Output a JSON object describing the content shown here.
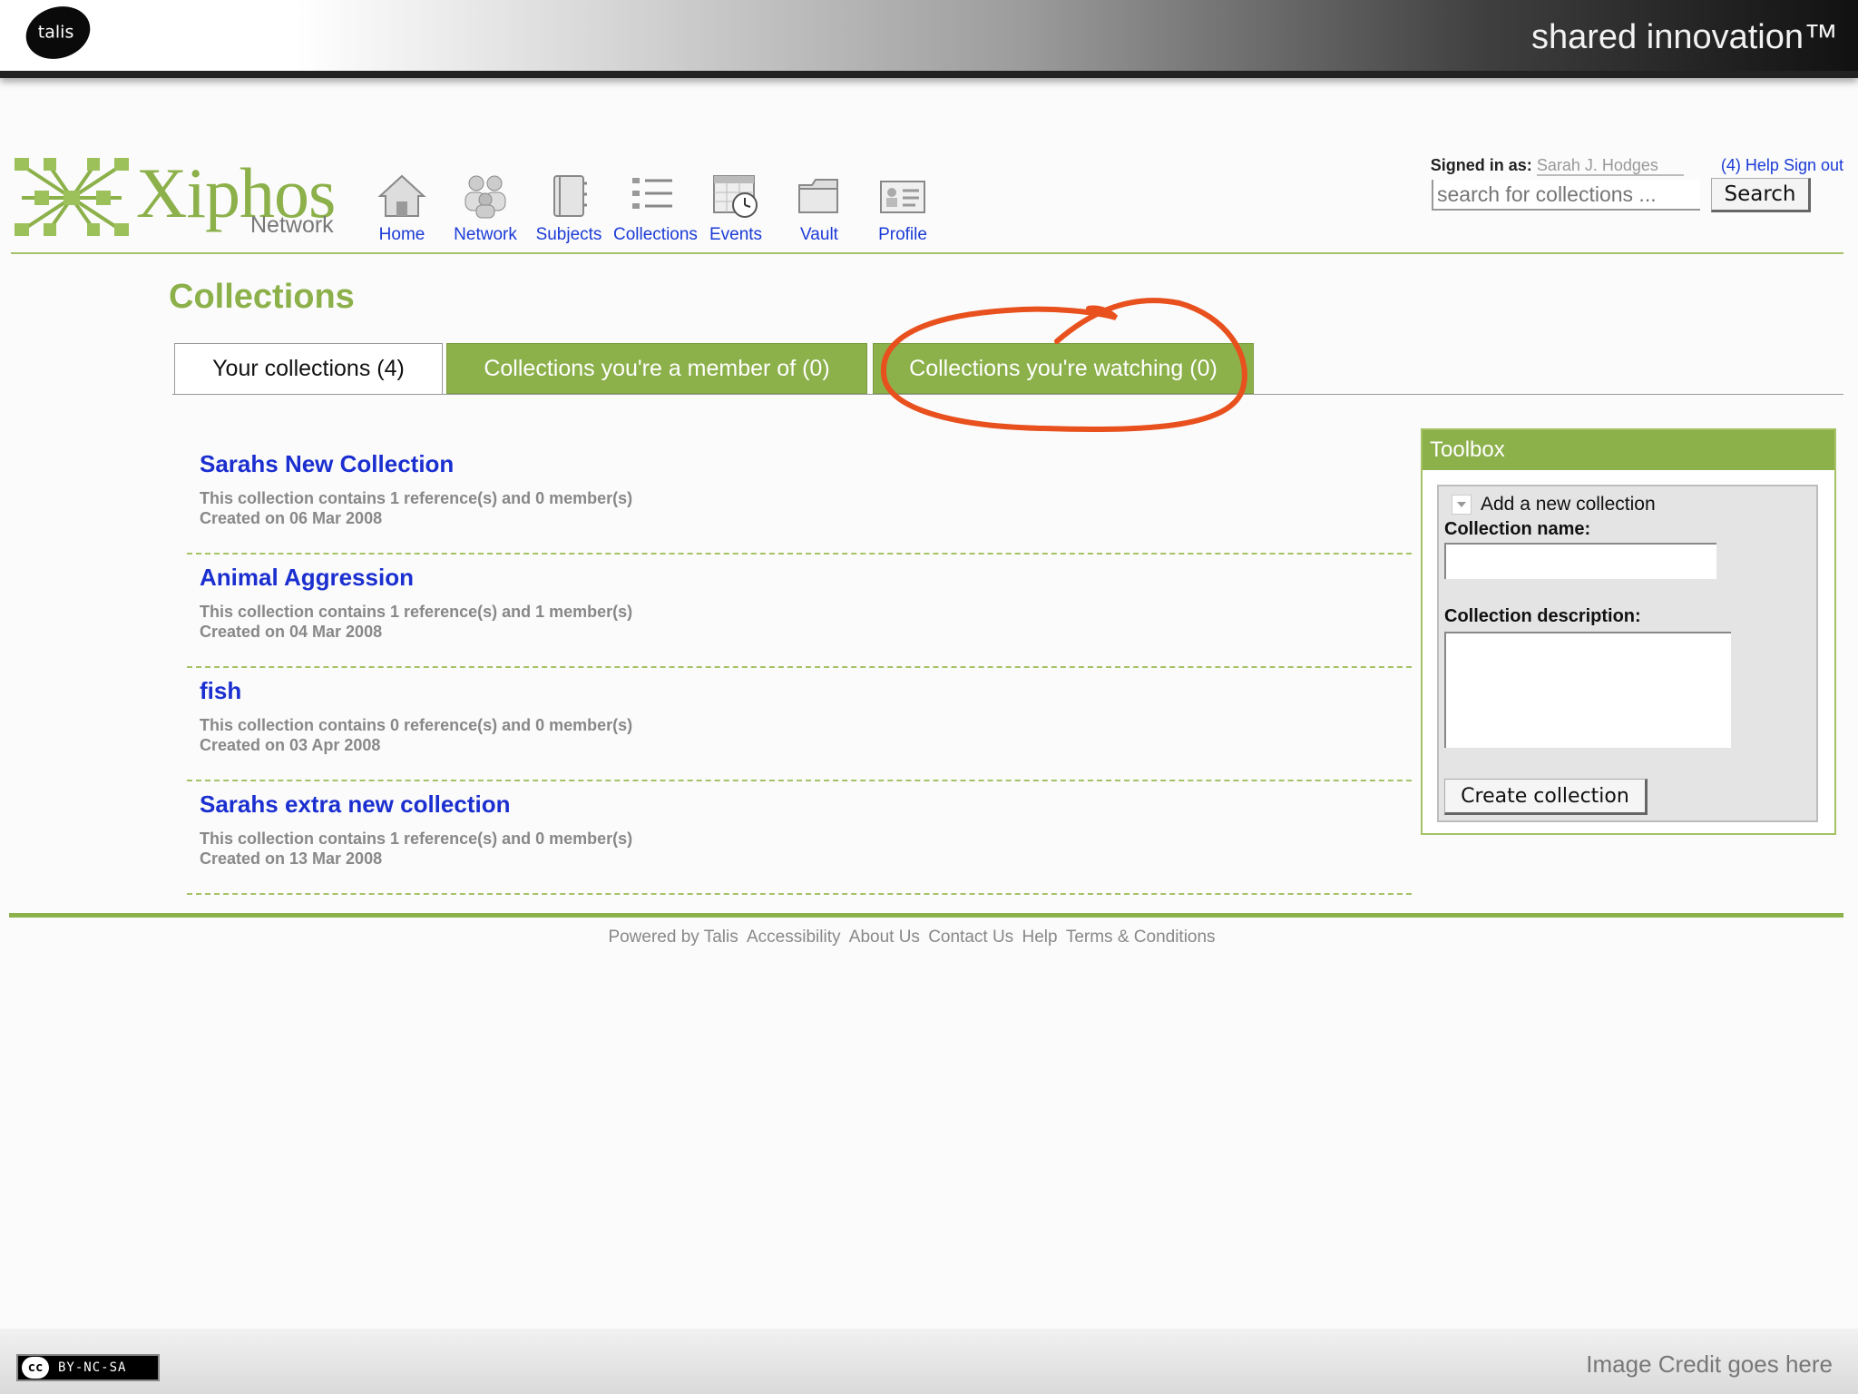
{
  "banner": {
    "logo_text": "talis",
    "tagline": "shared innovation™"
  },
  "header": {
    "logo_word": "Xiphos",
    "logo_sub": "Network",
    "nav": [
      {
        "label": "Home",
        "icon": "home-icon"
      },
      {
        "label": "Network",
        "icon": "people-icon"
      },
      {
        "label": "Subjects",
        "icon": "notebook-icon"
      },
      {
        "label": "Collections",
        "icon": "list-icon"
      },
      {
        "label": "Events",
        "icon": "calendar-clock-icon"
      },
      {
        "label": "Vault",
        "icon": "folder-icon"
      },
      {
        "label": "Profile",
        "icon": "profile-card-icon"
      }
    ],
    "signed_in_label": "Signed in as:",
    "user": "Sarah J. Hodges",
    "links": "(4) Help Sign out",
    "search_placeholder": "search for collections ...",
    "search_button": "Search"
  },
  "page": {
    "title": "Collections",
    "tabs": [
      {
        "label": "Your collections (4)",
        "active": true
      },
      {
        "label": "Collections you're a member of (0)",
        "active": false
      },
      {
        "label": "Collections you're watching (0)",
        "active": false
      }
    ],
    "annotation_color": "#e8501d"
  },
  "collections": [
    {
      "name": "Sarahs New Collection",
      "summary": "This collection contains 1 reference(s) and 0 member(s)",
      "created": "Created on 06 Mar 2008"
    },
    {
      "name": "Animal Aggression",
      "summary": "This collection contains 1 reference(s) and 1 member(s)",
      "created": "Created on 04 Mar 2008"
    },
    {
      "name": "fish",
      "summary": "This collection contains 0 reference(s) and 0 member(s)",
      "created": "Created on 03 Apr 2008"
    },
    {
      "name": "Sarahs extra new collection",
      "summary": "This collection contains 1 reference(s) and 0 member(s)",
      "created": "Created on 13 Mar 2008"
    }
  ],
  "toolbox": {
    "title": "Toolbox",
    "add_label": "Add a new collection",
    "name_label": "Collection name:",
    "description_label": "Collection description:",
    "create_button": "Create collection"
  },
  "footer": {
    "links": [
      "Powered by Talis",
      "Accessibility",
      "About Us",
      "Contact Us",
      "Help",
      "Terms & Conditions"
    ]
  },
  "slide": {
    "license": "BY-NC-SA",
    "license_mark": "cc",
    "credit": "Image Credit goes here"
  },
  "colors": {
    "accent_green": "#8cb04a",
    "link_blue": "#1b2fd0"
  }
}
